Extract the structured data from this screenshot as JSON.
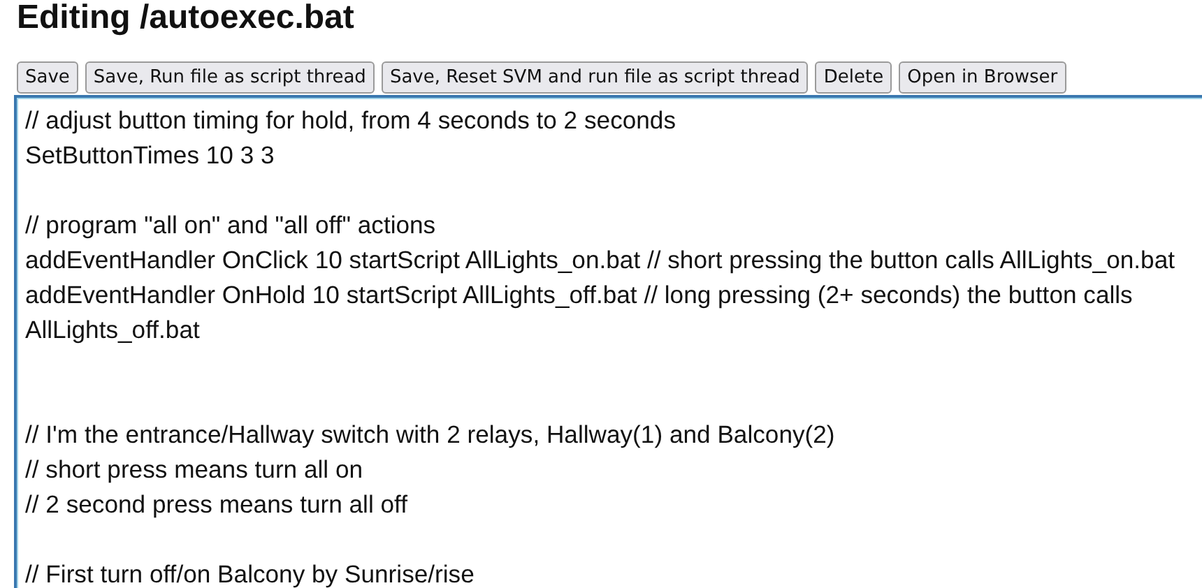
{
  "page_title": "Editing /autoexec.bat",
  "buttons": [
    {
      "label": "Save"
    },
    {
      "label": "Save, Run file as script thread"
    },
    {
      "label": "Save, Reset SVM and run file as script thread"
    },
    {
      "label": "Delete"
    },
    {
      "label": "Open in Browser"
    }
  ],
  "editor": {
    "lines": [
      {
        "kind": "code",
        "text": "// adjust button timing for hold, from 4 seconds to 2 seconds"
      },
      {
        "kind": "code",
        "text": "SetButtonTimes 10 3 3"
      },
      {
        "kind": "blank"
      },
      {
        "kind": "code",
        "text": "// program \"all on\" and \"all off\" actions"
      },
      {
        "kind": "code",
        "text": "addEventHandler OnClick 10 startScript AllLights_on.bat // short pressing the button calls AllLights_on.bat"
      },
      {
        "kind": "code",
        "text": "addEventHandler OnHold 10 startScript AllLights_off.bat // long pressing (2+ seconds) the button calls AllLights_off.bat"
      },
      {
        "kind": "blank"
      },
      {
        "kind": "blank"
      },
      {
        "kind": "code",
        "text": "// I'm the entrance/Hallway switch with 2 relays, Hallway(1) and Balcony(2)"
      },
      {
        "kind": "code",
        "text": "// short press means turn all on"
      },
      {
        "kind": "code",
        "text": "// 2 second press means turn all off"
      },
      {
        "kind": "blank"
      },
      {
        "kind": "code",
        "text": "// First turn off/on Balcony by Sunrise/rise"
      }
    ]
  }
}
